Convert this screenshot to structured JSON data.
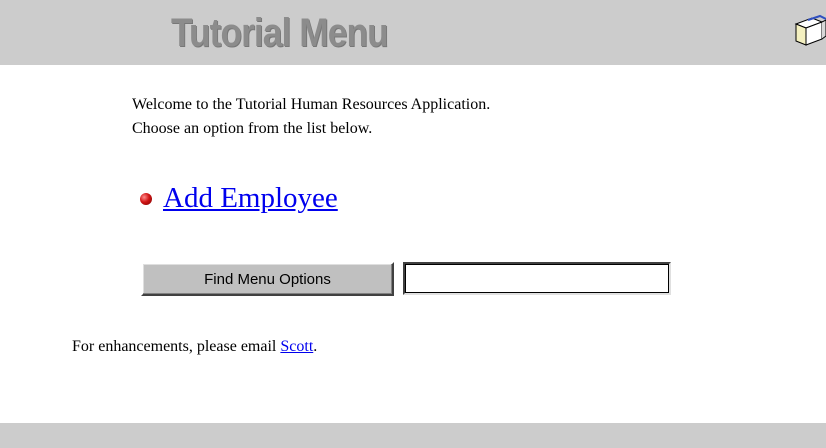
{
  "header": {
    "title": "Tutorial Menu",
    "background_color": "#cccccc",
    "icon": "book-icon"
  },
  "intro": {
    "line1": "Welcome to the Tutorial Human Resources Application.",
    "line2": "Choose an option from the list below."
  },
  "menu": {
    "options": [
      {
        "label": "Add Employee",
        "bullet_color": "#cc0000"
      }
    ]
  },
  "find": {
    "button_label": "Find Menu Options",
    "input_value": ""
  },
  "footer": {
    "text_before": "For enhancements, please email ",
    "link_text": "Scott",
    "text_after": "."
  },
  "colors": {
    "link": "#0000ee",
    "bar": "#cccccc"
  }
}
